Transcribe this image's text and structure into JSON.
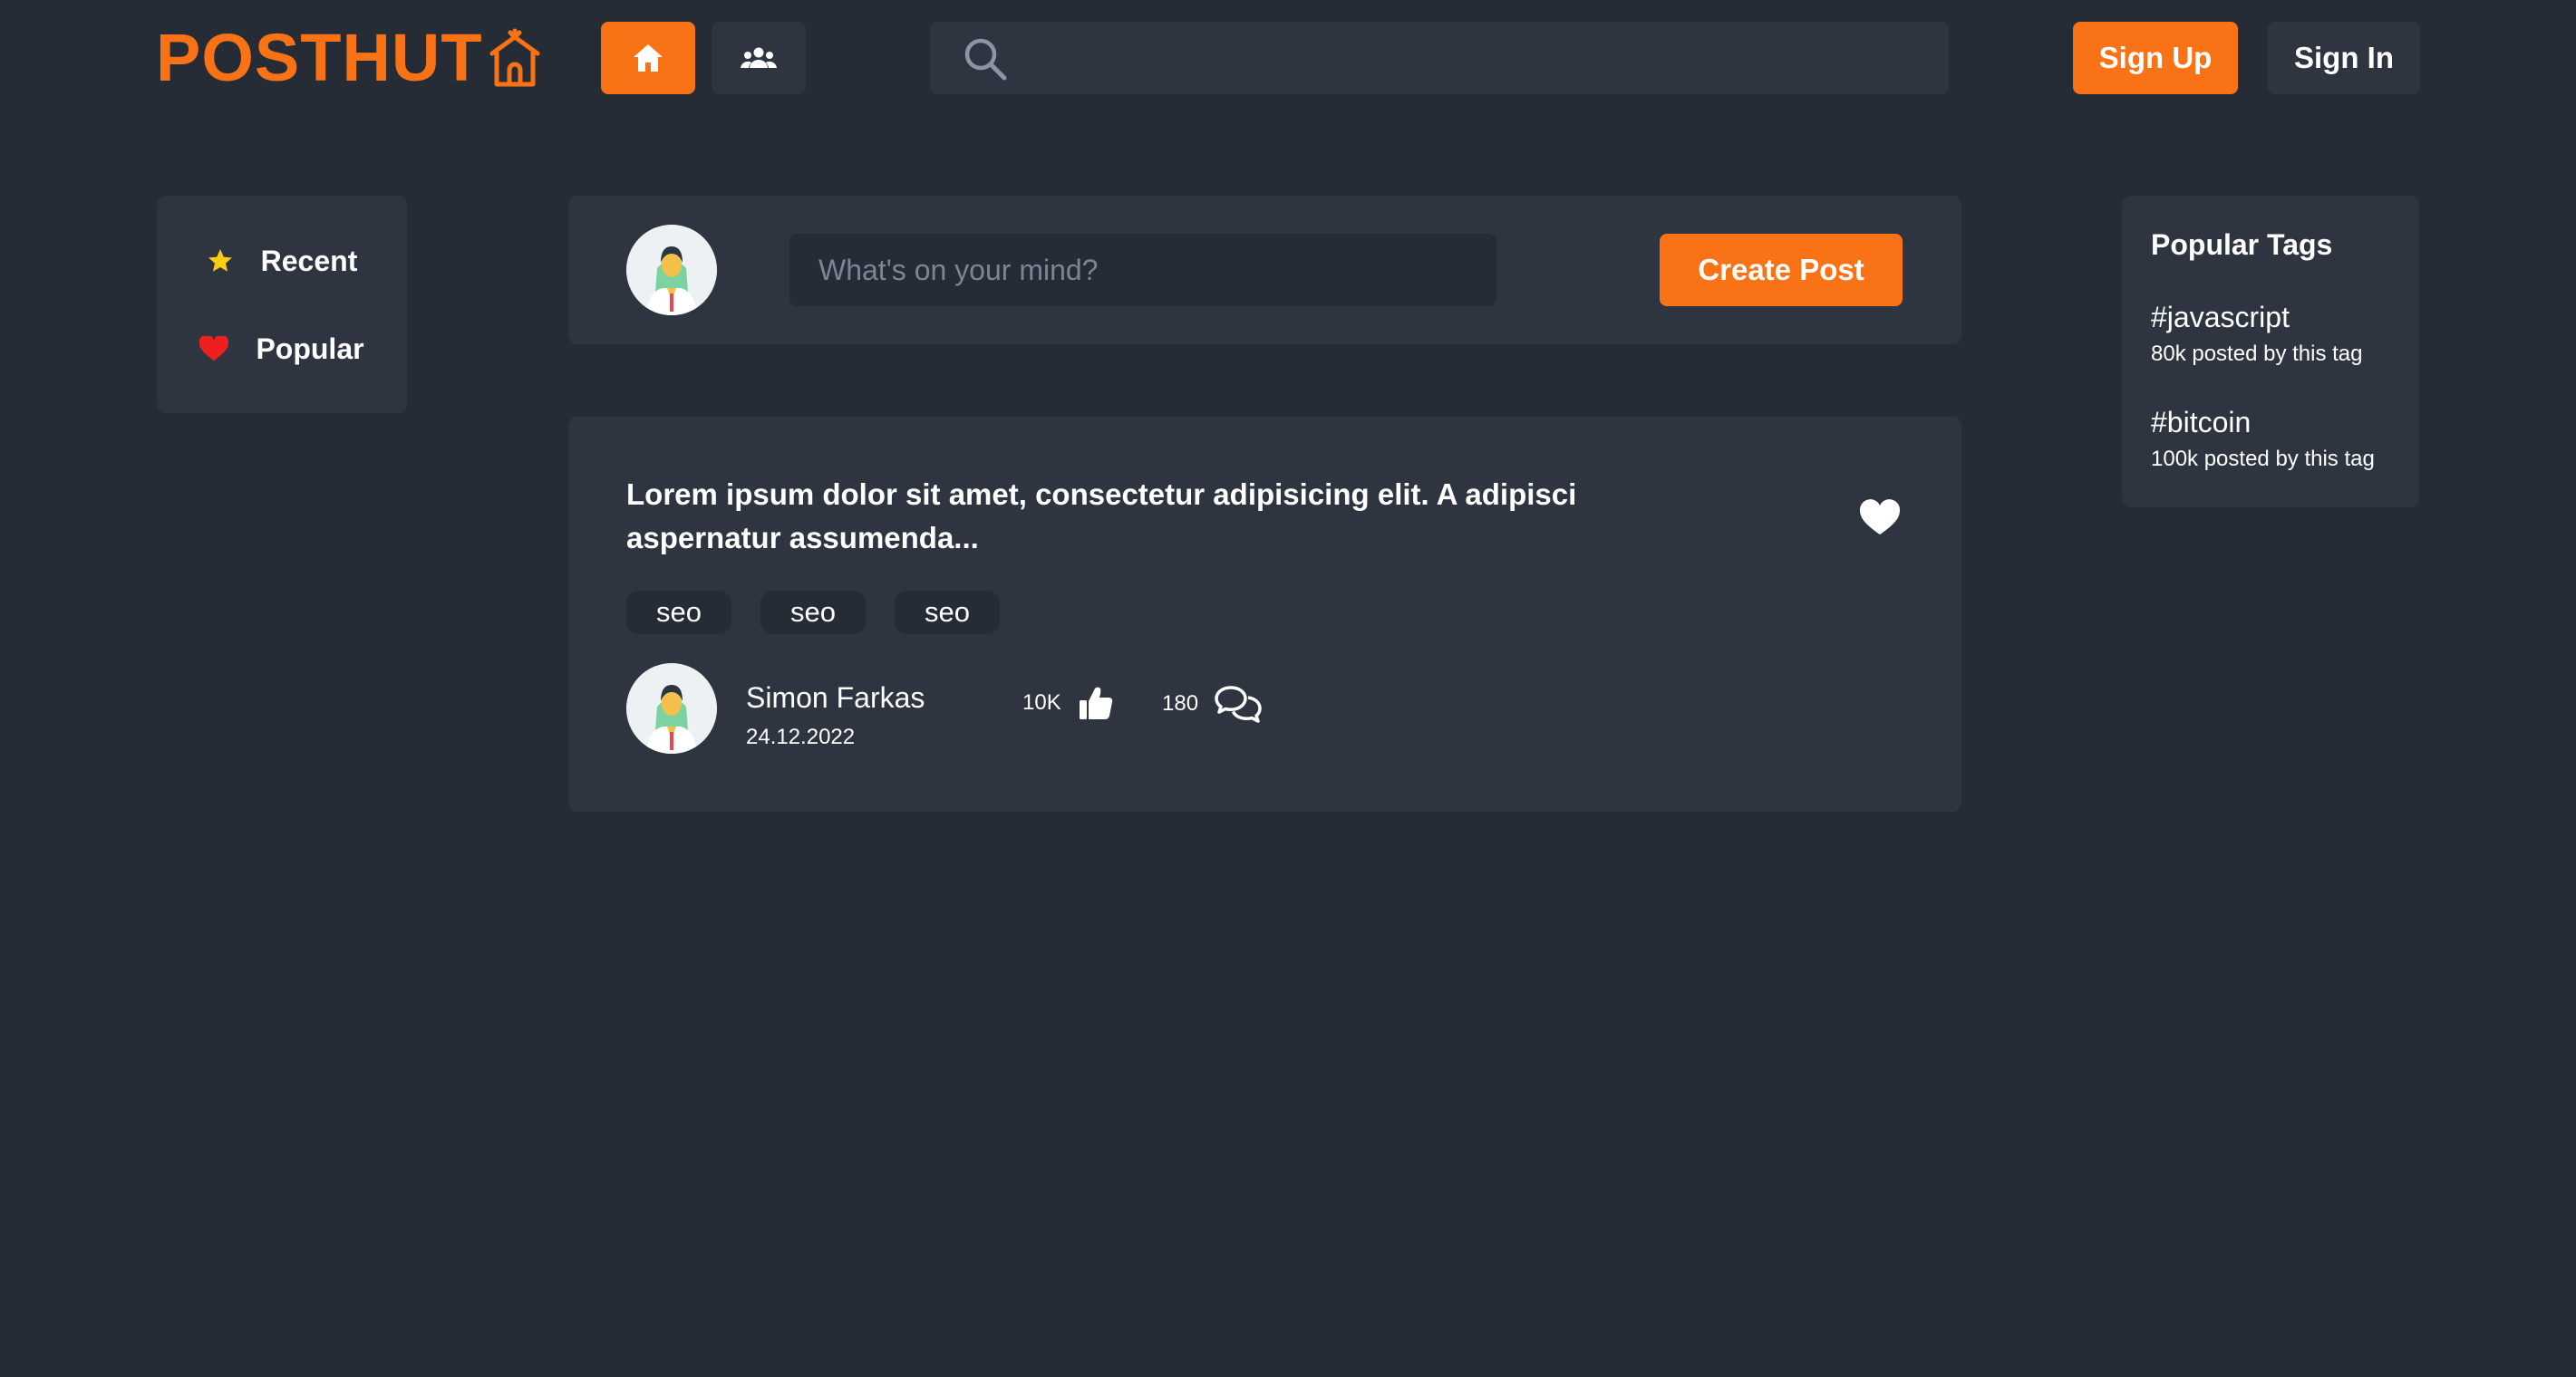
{
  "header": {
    "logo_text": "POSTHUT",
    "search": {
      "value": "",
      "placeholder": ""
    },
    "sign_up_label": "Sign Up",
    "sign_in_label": "Sign In"
  },
  "sidebar": {
    "items": [
      {
        "label": "Recent",
        "icon": "star-icon"
      },
      {
        "label": "Popular",
        "icon": "heart-icon"
      }
    ]
  },
  "composer": {
    "placeholder": "What's on your mind?",
    "button_label": "Create Post"
  },
  "post": {
    "title": "Lorem ipsum dolor sit amet, consectetur adipisicing elit. A adipisci aspernatur assumenda...",
    "tags": [
      "seo",
      "seo",
      "seo"
    ],
    "author": "Simon Farkas",
    "date": "24.12.2022",
    "likes": "10K",
    "comments": "180"
  },
  "popular_tags": {
    "heading": "Popular Tags",
    "items": [
      {
        "name": "#javascript",
        "count": "80k posted by this tag"
      },
      {
        "name": "#bitcoin",
        "count": "100k posted by this tag"
      }
    ]
  },
  "colors": {
    "background": "#262c35",
    "surface": "#2e3540",
    "accent": "#f97316",
    "star": "#facc15",
    "heart": "#ef1f1f"
  }
}
